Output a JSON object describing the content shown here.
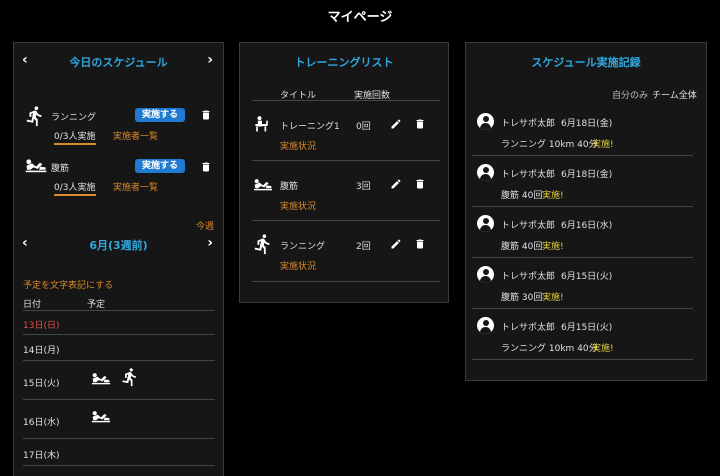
{
  "page": {
    "title": "マイページ"
  },
  "today": {
    "title": "今日のスケジュール",
    "prev": "‹",
    "next": "›",
    "items": [
      {
        "name": "ランニング",
        "button": "実施する",
        "count": "0/3人実施",
        "link": "実施者一覧",
        "icon": "running-icon"
      },
      {
        "name": "腹筋",
        "button": "実施する",
        "count": "0/3人実施",
        "link": "実施者一覧",
        "icon": "situp-icon"
      }
    ],
    "this_week": "今週",
    "month_label": "6月(3週前)",
    "text_toggle": "予定を文字表記にする",
    "col_date": "日付",
    "col_plan": "予定",
    "days": [
      {
        "date": "13日(日)",
        "highlight": true
      },
      {
        "date": "14日(月)"
      },
      {
        "date": "15日(火)"
      },
      {
        "date": "16日(水)"
      },
      {
        "date": "17日(木)"
      }
    ]
  },
  "training_list": {
    "title": "トレーニングリスト",
    "col_title": "タイトル",
    "col_count": "実施回数",
    "items": [
      {
        "name": "トレーニング1",
        "count": "0回",
        "status": "実施状況",
        "icon": "bench-icon"
      },
      {
        "name": "腹筋",
        "count": "3回",
        "status": "実施状況",
        "icon": "situp-icon"
      },
      {
        "name": "ランニング",
        "count": "2回",
        "status": "実施状況",
        "icon": "running-icon"
      }
    ]
  },
  "records": {
    "title": "スケジュール実施記録",
    "filter_self": "自分のみ",
    "filter_team": "チーム全体",
    "items": [
      {
        "user": "トレサポ太郎",
        "date": "6月18日(金)",
        "detail": "ランニング  10km  40分",
        "done": "実施!"
      },
      {
        "user": "トレサポ太郎",
        "date": "6月18日(金)",
        "detail": "腹筋  40回",
        "done": "実施!"
      },
      {
        "user": "トレサポ太郎",
        "date": "6月16日(水)",
        "detail": "腹筋  40回",
        "done": "実施!"
      },
      {
        "user": "トレサポ太郎",
        "date": "6月15日(火)",
        "detail": "腹筋  30回",
        "done": "実施!"
      },
      {
        "user": "トレサポ太郎",
        "date": "6月15日(火)",
        "detail": "ランニング  10km  40分",
        "done": "実施!"
      }
    ]
  },
  "colors": {
    "accent_blue": "#2fa8e0",
    "button_blue": "#1f7ad1",
    "orange": "#d98a2b",
    "done_yellow": "#e6d23a",
    "today_red": "#e0524a"
  }
}
